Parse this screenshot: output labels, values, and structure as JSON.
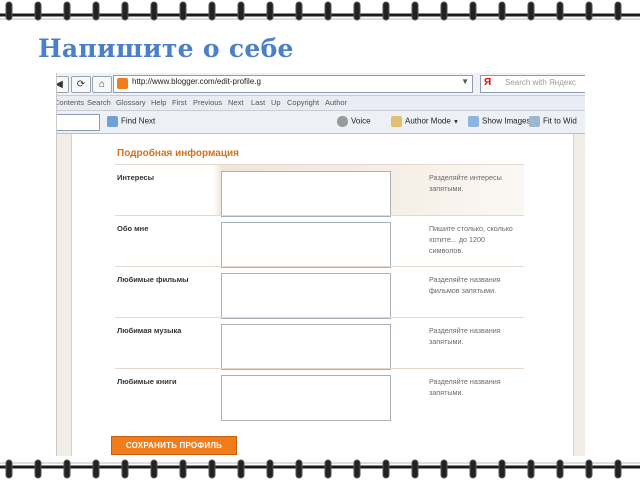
{
  "slide": {
    "title": "Напишите о себе"
  },
  "browser": {
    "url": "http://www.blogger.com/edit-profile.g",
    "search_placeholder": "Search with Яндекс",
    "search_logo": "Я",
    "nav_back_icon": "back-arrow-icon",
    "nav_reload_icon": "reload-icon",
    "nav_home_icon": "home-icon"
  },
  "menubar": [
    "Contents",
    "Search",
    "Glossary",
    "Help",
    "First",
    "Previous",
    "Next",
    "Last",
    "Up",
    "Copyright",
    "Author"
  ],
  "toolbar": {
    "find_next": "Find Next",
    "voice": "Voice",
    "author_mode": "Author Mode",
    "show_images": "Show Images",
    "fit_to_width": "Fit to Wid"
  },
  "form": {
    "section_title": "Подробная информация",
    "rows": [
      {
        "label": "Интересы",
        "hint": "Разделяйте интересы запятыми."
      },
      {
        "label": "Обо мне",
        "hint": "Пишите столько, сколько хотите... до 1200 символов."
      },
      {
        "label": "Любимые фильмы",
        "hint": "Разделяйте названия фильмов запятыми."
      },
      {
        "label": "Любимая музыка",
        "hint": "Разделяйте названия запятыми."
      },
      {
        "label": "Любимые книги",
        "hint": "Разделяйте названия запятыми."
      }
    ],
    "save_button": "СОХРАНИТЬ ПРОФИЛЬ"
  },
  "colors": {
    "accent": "#f07c1b",
    "title": "#4a7fc9"
  }
}
